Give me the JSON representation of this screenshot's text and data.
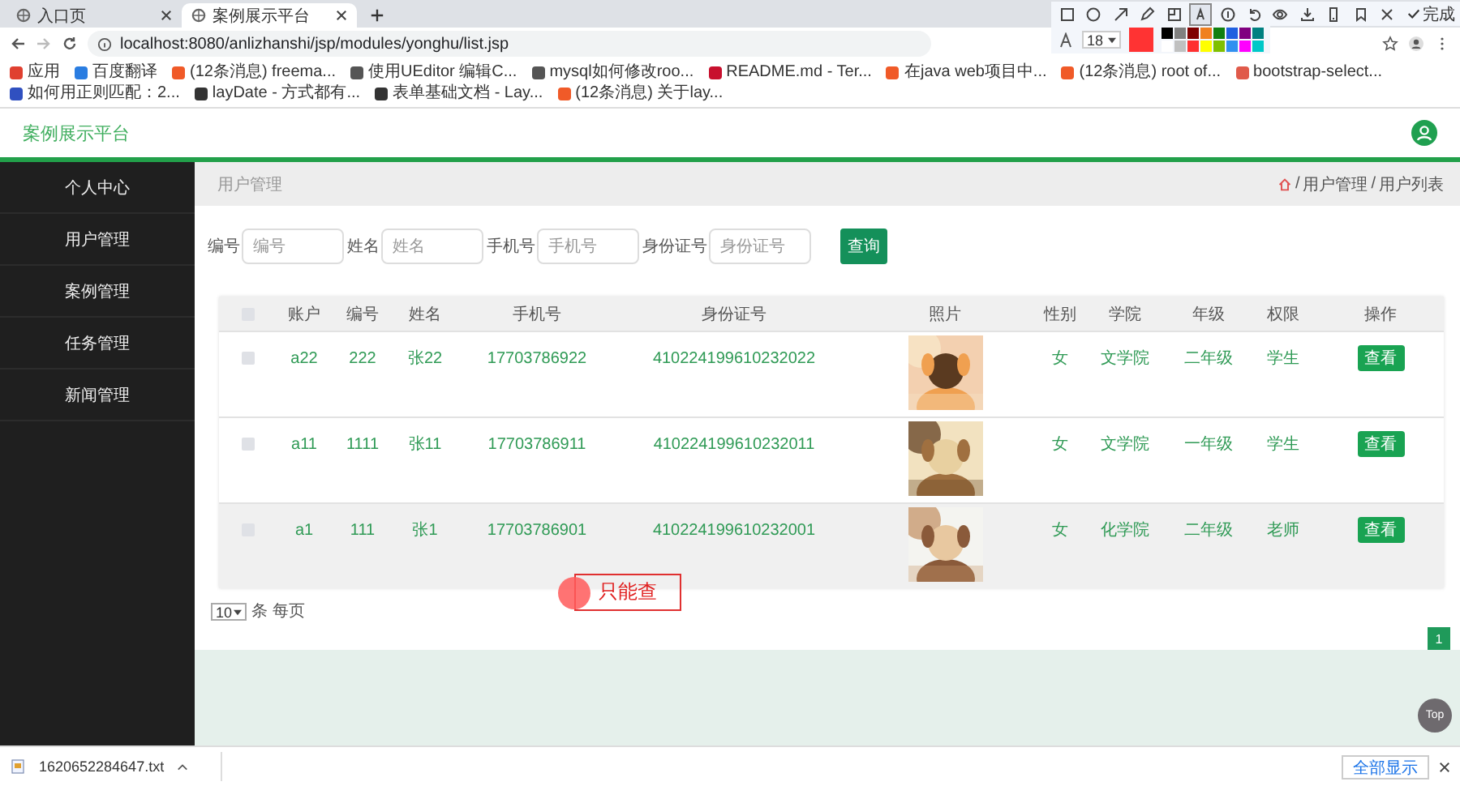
{
  "browser": {
    "tabs": [
      {
        "title": "入口页",
        "selected": false
      },
      {
        "title": "案例展示平台",
        "selected": true
      }
    ],
    "url": "localhost:8080/anlizhanshi/jsp/modules/yonghu/list.jsp",
    "bookmarks": [
      {
        "title": "应用",
        "color": "#e04030"
      },
      {
        "title": "百度翻译",
        "color": "#2a7de1"
      },
      {
        "title": "(12条消息) freema...",
        "color": "#f05a28"
      },
      {
        "title": "使用UEditor 编辑C...",
        "color": "#555555"
      },
      {
        "title": "mysql如何修改roo...",
        "color": "#555555"
      },
      {
        "title": "README.md - Ter...",
        "color": "#c8102e"
      },
      {
        "title": "在java web项目中...",
        "color": "#f05a28"
      },
      {
        "title": "(12条消息) root of...",
        "color": "#f05a28"
      },
      {
        "title": "bootstrap-select...",
        "color": "#e05a4a"
      },
      {
        "title": "如何用正则匹配：2...",
        "color": "#3050c0"
      },
      {
        "title": "layDate - 方式都有...",
        "color": "#333333"
      },
      {
        "title": "表单基础文档 - Lay...",
        "color": "#333333"
      },
      {
        "title": "(12条消息) 关于lay...",
        "color": "#f05a28"
      }
    ]
  },
  "capture_toolbar": {
    "tools": [
      {
        "kind": "rectangle",
        "selected": false
      },
      {
        "kind": "ellipse",
        "selected": false
      },
      {
        "kind": "arrow",
        "selected": false
      },
      {
        "kind": "pencil",
        "selected": false
      },
      {
        "kind": "mosaic",
        "selected": false
      },
      {
        "kind": "text",
        "selected": true
      },
      {
        "kind": "number",
        "selected": false
      },
      {
        "kind": "undo",
        "selected": false
      },
      {
        "kind": "eye",
        "selected": false
      },
      {
        "kind": "download",
        "selected": false
      },
      {
        "kind": "phone",
        "selected": false
      },
      {
        "kind": "bookmark",
        "selected": false
      },
      {
        "kind": "close",
        "selected": false
      }
    ],
    "done_label": "完成",
    "font_size": "18",
    "current_swatch": {
      "color": "#ff3333"
    },
    "palette": [
      {
        "color": "#000000"
      },
      {
        "color": "#808080"
      },
      {
        "color": "#800000"
      },
      {
        "color": "#f08020"
      },
      {
        "color": "#108010"
      },
      {
        "color": "#2060e0"
      },
      {
        "color": "#800080"
      },
      {
        "color": "#008080"
      },
      {
        "color": "#ffffff"
      },
      {
        "color": "#c0c0c0"
      },
      {
        "color": "#ff3030"
      },
      {
        "color": "#ffff00"
      },
      {
        "color": "#80c000"
      },
      {
        "color": "#3090f0"
      },
      {
        "color": "#ff00ff"
      },
      {
        "color": "#00c8c8"
      }
    ]
  },
  "app": {
    "title": "案例展示平台",
    "sidebar": {
      "items": [
        {
          "label": "个人中心"
        },
        {
          "label": "用户管理"
        },
        {
          "label": "案例管理"
        },
        {
          "label": "任务管理"
        },
        {
          "label": "新闻管理"
        }
      ]
    },
    "breadcrumb": {
      "title": "用户管理",
      "separator": "/",
      "trail": [
        "用户管理",
        "用户列表"
      ]
    },
    "search": {
      "fields": [
        {
          "label": "编号",
          "placeholder": "编号"
        },
        {
          "label": "姓名",
          "placeholder": "姓名"
        },
        {
          "label": "手机号",
          "placeholder": "手机号"
        },
        {
          "label": "身份证号",
          "placeholder": "身份证号"
        }
      ],
      "button": "查询"
    },
    "table": {
      "header_checkbox": {
        "checked": false
      },
      "columns": [
        "账户",
        "编号",
        "姓名",
        "手机号",
        "身份证号",
        "照片",
        "性别",
        "学院",
        "年级",
        "权限",
        "操作"
      ],
      "rows": [
        {
          "checked": false,
          "highlighted": false,
          "account": "a22",
          "number": "222",
          "name": "张22",
          "phone": "17703786922",
          "id_card": "410224199610232022",
          "gender": "女",
          "college": "文学院",
          "grade": "二年级",
          "role": "学生",
          "action": "查看"
        },
        {
          "checked": false,
          "highlighted": false,
          "account": "a11",
          "number": "1111",
          "name": "张11",
          "phone": "17703786911",
          "id_card": "410224199610232011",
          "gender": "女",
          "college": "文学院",
          "grade": "一年级",
          "role": "学生",
          "action": "查看"
        },
        {
          "checked": false,
          "highlighted": true,
          "account": "a1",
          "number": "111",
          "name": "张1",
          "phone": "17703786901",
          "id_card": "410224199610232001",
          "gender": "女",
          "college": "化学院",
          "grade": "二年级",
          "role": "老师",
          "action": "查看"
        }
      ]
    },
    "pagination": {
      "page_size": "10",
      "per_page_label": "条 每页",
      "pages": [
        {
          "label": "1",
          "selected": true
        }
      ]
    },
    "back_to_top": "Top"
  },
  "annotation": {
    "text": "只能查"
  },
  "download_bar": {
    "file": "1620652284647.txt",
    "show_all": "全部显示"
  }
}
